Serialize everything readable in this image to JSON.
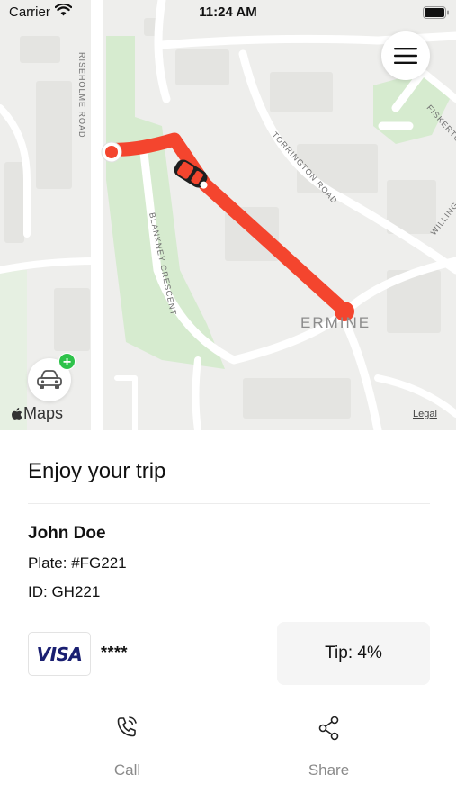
{
  "status_bar": {
    "carrier": "Carrier",
    "time": "11:24 AM"
  },
  "map": {
    "streets": [
      "RISEHOLME ROAD",
      "TORRINGTON ROAD",
      "BLANKNEY CRESCENT",
      "FISKERTON",
      "WILLING",
      "ERMINE"
    ],
    "brand": "Maps",
    "legal": "Legal",
    "route_color": "#f4452e",
    "park_color": "#cfe7c5"
  },
  "trip": {
    "title": "Enjoy your trip",
    "driver_name": "John Doe",
    "plate": "Plate: #FG221",
    "id": "ID: GH221",
    "card_brand": "VISA",
    "card_mask": "****",
    "tip": "Tip: 4%"
  },
  "actions": {
    "call": "Call",
    "share": "Share"
  },
  "icons": [
    "wifi-icon",
    "battery-icon",
    "hamburger-menu-icon",
    "car-icon",
    "plus-icon",
    "apple-logo-icon",
    "phone-call-icon",
    "share-icon"
  ]
}
